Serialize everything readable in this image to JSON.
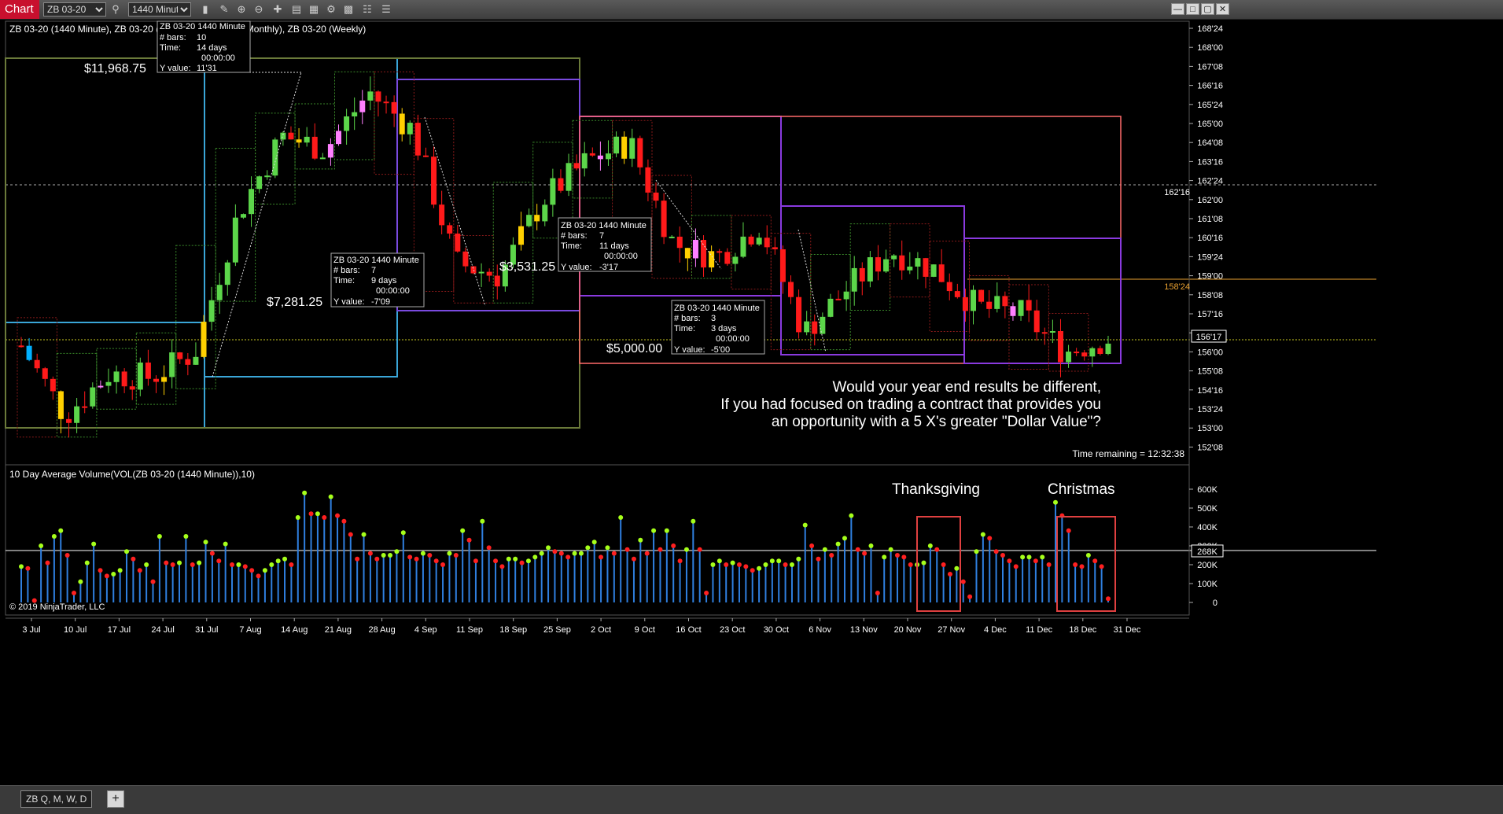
{
  "toolbar": {
    "chart_tab": "Chart",
    "instrument": "ZB 03-20",
    "interval": "1440 Minute"
  },
  "price_panel": {
    "legend": "ZB 03-20 (1440 Minute), ZB 03-20 (3 Month), ZB 03-20 (Monthly), ZB 03-20 (Weekly)",
    "time_remaining": "Time remaining = 12:32:38",
    "y_ticks": [
      "168'24",
      "168'00",
      "167'08",
      "166'16",
      "165'24",
      "165'00",
      "164'08",
      "163'16",
      "162'24",
      "162'00",
      "161'08",
      "160'16",
      "159'24",
      "159'00",
      "158'08",
      "157'16",
      "156'24",
      "156'00",
      "155'08",
      "154'16",
      "153'24",
      "153'00",
      "152'08"
    ],
    "markers": [
      {
        "label": "162'16",
        "color": "#ffffff"
      },
      {
        "label": "158'24",
        "color": "#e8a030"
      },
      {
        "label": "156'17",
        "color": "#ffffff"
      }
    ],
    "dollar_labels": [
      "$11,968.75",
      "$7,281.25",
      "$3,531.25",
      "$5,000.00"
    ],
    "message": [
      "Would your year end results be different,",
      "If you had focused on trading a contract that provides you",
      "an opportunity with a 5 X's greater \"Dollar Value\"?"
    ],
    "ruler_boxes": [
      {
        "title": "ZB 03-20 1440 Minute",
        "bars_label": "# bars:",
        "bars": "10",
        "time_label": "Time:",
        "days": "14 days",
        "clock": "00:00:00",
        "yv_label": "Y value:",
        "yv": "11'31"
      },
      {
        "title": "ZB 03-20 1440 Minute",
        "bars_label": "# bars:",
        "bars": "7",
        "time_label": "Time:",
        "days": "9 days",
        "clock": "00:00:00",
        "yv_label": "Y value:",
        "yv": "-7'09"
      },
      {
        "title": "ZB 03-20 1440 Minute",
        "bars_label": "# bars:",
        "bars": "7",
        "time_label": "Time:",
        "days": "11 days",
        "clock": "00:00:00",
        "yv_label": "Y value:",
        "yv": "-3'17"
      },
      {
        "title": "ZB 03-20 1440 Minute",
        "bars_label": "# bars:",
        "bars": "3",
        "time_label": "Time:",
        "days": "3 days",
        "clock": "00:00:00",
        "yv_label": "Y value:",
        "yv": "-5'00"
      }
    ]
  },
  "volume_panel": {
    "legend": "10 Day Average Volume(VOL(ZB 03-20 (1440 Minute)),10)",
    "y_ticks": [
      "600K",
      "500K",
      "400K",
      "300K",
      "200K",
      "100K",
      "0"
    ],
    "current_value": "268K",
    "annotations": [
      "Thanksgiving",
      "Christmas"
    ],
    "copyright": "© 2019 NinjaTrader, LLC"
  },
  "x_axis": [
    "3 Jul",
    "10 Jul",
    "17 Jul",
    "24 Jul",
    "31 Jul",
    "7 Aug",
    "14 Aug",
    "21 Aug",
    "28 Aug",
    "4 Sep",
    "11 Sep",
    "18 Sep",
    "25 Sep",
    "2 Oct",
    "9 Oct",
    "16 Oct",
    "23 Oct",
    "30 Oct",
    "6 Nov",
    "13 Nov",
    "20 Nov",
    "27 Nov",
    "4 Dec",
    "11 Dec",
    "18 Dec",
    "31 Dec"
  ],
  "bottom_bar": {
    "tab_label": "ZB  Q, M, W, D",
    "add_label": "+"
  },
  "colors": {
    "up": "#5cd64a",
    "down": "#ff1a1a",
    "doji_up": "#ffd000",
    "doji_down": "#ff80ff",
    "cyan_bar": "#00b0ff",
    "volume_stem": "#2f7fdf",
    "vol_up": "#a6ff1a",
    "vol_down": "#ff2020"
  },
  "chart_data": [
    {
      "type": "candlestick",
      "title": "ZB 03-20 (1440 Minute)",
      "price_unit": "32nds (e.g. 156'17)",
      "ylim": [
        "152'08",
        "168'24"
      ],
      "approx_close_path": [
        {
          "x": "3 Jul",
          "close": "156'08"
        },
        {
          "x": "10 Jul",
          "close": "153'16"
        },
        {
          "x": "17 Jul",
          "close": "155'04"
        },
        {
          "x": "24 Jul",
          "close": "155'00"
        },
        {
          "x": "31 Jul",
          "close": "156'00"
        },
        {
          "x": "7 Aug",
          "close": "161'16"
        },
        {
          "x": "14 Aug",
          "close": "164'16"
        },
        {
          "x": "21 Aug",
          "close": "164'00"
        },
        {
          "x": "28 Aug",
          "close": "166'08"
        },
        {
          "x": "4 Sep",
          "close": "164'24"
        },
        {
          "x": "11 Sep",
          "close": "159'16"
        },
        {
          "x": "18 Sep",
          "close": "159'00"
        },
        {
          "x": "25 Sep",
          "close": "162'00"
        },
        {
          "x": "2 Oct",
          "close": "163'16"
        },
        {
          "x": "9 Oct",
          "close": "164'08"
        },
        {
          "x": "16 Oct",
          "close": "160'08"
        },
        {
          "x": "23 Oct",
          "close": "159'24"
        },
        {
          "x": "30 Oct",
          "close": "161'00"
        },
        {
          "x": "6 Nov",
          "close": "156'24"
        },
        {
          "x": "13 Nov",
          "close": "158'16"
        },
        {
          "x": "20 Nov",
          "close": "160'00"
        },
        {
          "x": "27 Nov",
          "close": "159'08"
        },
        {
          "x": "4 Dec",
          "close": "157'24"
        },
        {
          "x": "11 Dec",
          "close": "157'16"
        },
        {
          "x": "18 Dec",
          "close": "156'00"
        },
        {
          "x": "31 Dec",
          "close": "156'17"
        }
      ]
    },
    {
      "type": "bar",
      "title": "10 Day Average Volume(VOL(ZB 03-20 (1440 Minute)),10)",
      "ylim": [
        0,
        650000
      ],
      "values": [
        190000,
        180000,
        10000,
        300000,
        210000,
        350000,
        380000,
        250000,
        50000,
        110000,
        210000,
        310000,
        170000,
        140000,
        150000,
        170000,
        270000,
        230000,
        170000,
        200000,
        110000,
        350000,
        210000,
        200000,
        210000,
        350000,
        200000,
        210000,
        320000,
        260000,
        220000,
        310000,
        200000,
        200000,
        190000,
        170000,
        140000,
        170000,
        200000,
        220000,
        230000,
        200000,
        450000,
        580000,
        470000,
        470000,
        450000,
        560000,
        460000,
        430000,
        360000,
        230000,
        360000,
        260000,
        230000,
        250000,
        250000,
        270000,
        370000,
        240000,
        230000,
        260000,
        250000,
        220000,
        200000,
        260000,
        250000,
        380000,
        330000,
        220000,
        430000,
        290000,
        220000,
        190000,
        230000,
        230000,
        210000,
        220000,
        240000,
        260000,
        290000,
        270000,
        260000,
        240000,
        260000,
        260000,
        290000,
        320000,
        240000,
        290000,
        260000,
        450000,
        280000,
        230000,
        330000,
        260000,
        380000,
        280000,
        380000,
        300000,
        220000,
        280000,
        430000,
        280000,
        50000,
        200000,
        220000,
        200000,
        210000,
        200000,
        190000,
        170000,
        180000,
        200000,
        220000,
        220000,
        200000,
        200000,
        230000,
        410000,
        300000,
        230000,
        280000,
        250000,
        310000,
        340000,
        460000,
        280000,
        260000,
        300000,
        50000,
        240000,
        280000,
        250000,
        240000,
        200000,
        200000,
        210000,
        300000,
        280000,
        200000,
        150000,
        180000,
        110000,
        30000,
        270000,
        360000,
        340000,
        270000,
        250000,
        220000,
        190000,
        240000,
        240000,
        220000,
        240000,
        200000,
        530000,
        460000,
        380000,
        200000,
        190000,
        250000,
        220000,
        190000,
        20000
      ]
    }
  ]
}
